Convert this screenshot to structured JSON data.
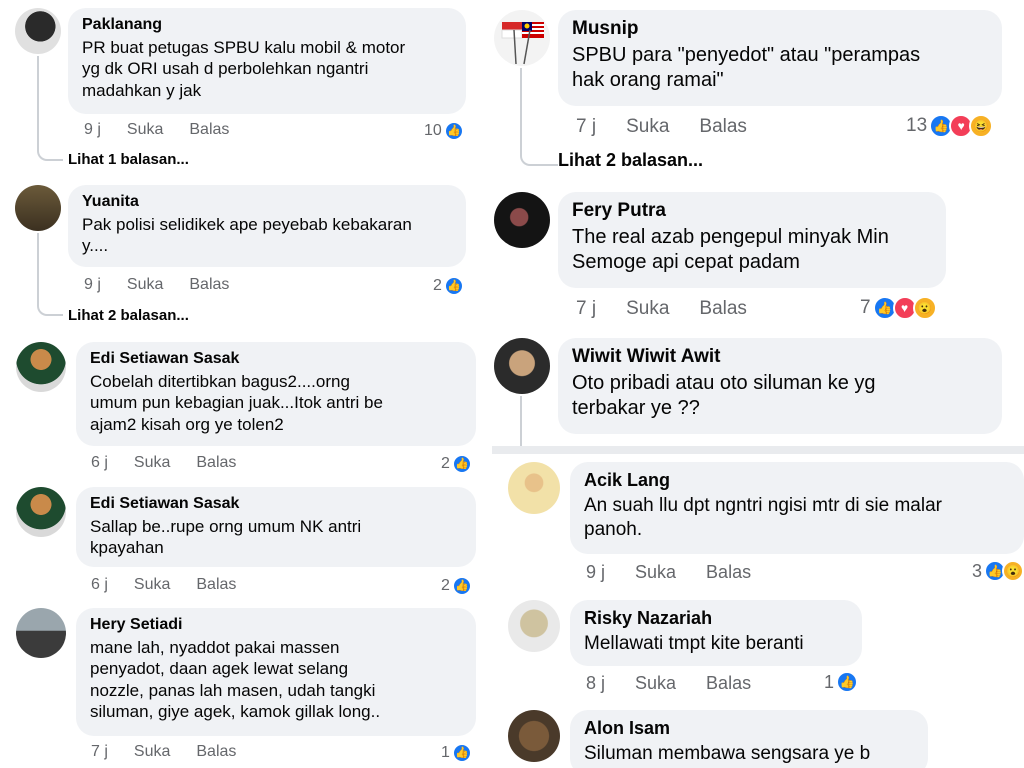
{
  "colors": {
    "like": "#1877f2",
    "love": "#f33e58",
    "haha": "#f7b125",
    "bubble": "#f0f2f5",
    "meta": "#65676b"
  },
  "left": {
    "comments": [
      {
        "name": "Paklanang",
        "text": "PR buat petugas SPBU kalu mobil & motor\nyg dk ORI usah d perbolehkan ngantri\nmadahkan y jak",
        "time": "9 j",
        "like": "Suka",
        "reply": "Balas",
        "count": "10",
        "replies": "Lihat 1 balasan..."
      },
      {
        "name": "Yuanita",
        "text": "Pak polisi selidikek ape peyebab kebakaran\ny....",
        "time": "9 j",
        "like": "Suka",
        "reply": "Balas",
        "count": "2",
        "replies": "Lihat 2 balasan..."
      },
      {
        "name": "Edi Setiawan Sasak",
        "text": "Cobelah ditertibkan bagus2....orng\numum pun kebagian juak...Itok antri be\najam2 kisah org ye tolen2",
        "time": "6 j",
        "like": "Suka",
        "reply": "Balas",
        "count": "2"
      },
      {
        "name": "Edi Setiawan Sasak",
        "text": "Sallap be..rupe orng umum NK antri\nkpayahan",
        "time": "6 j",
        "like": "Suka",
        "reply": "Balas",
        "count": "2"
      },
      {
        "name": "Hery Setiadi",
        "text": "mane lah, nyaddot pakai massen\npenyadot, daan agek lewat selang\nnozzle, panas lah masen, udah tangki\nsiluman, giye agek, kamok gillak long..",
        "time": "7 j",
        "like": "Suka",
        "reply": "Balas",
        "count": "1"
      }
    ]
  },
  "right_top": {
    "comments": [
      {
        "name": "Musnip",
        "text": "SPBU para \"penyedot\" atau \"perampas\nhak orang ramai\"",
        "time": "7 j",
        "like": "Suka",
        "reply": "Balas",
        "count": "13",
        "replies": "Lihat 2 balasan..."
      },
      {
        "name": "Fery Putra",
        "text": "The real azab pengepul minyak Min\nSemoge api cepat padam",
        "time": "7 j",
        "like": "Suka",
        "reply": "Balas",
        "count": "7"
      },
      {
        "name": "Wiwit Wiwit Awit",
        "text": "Oto pribadi atau oto siluman ke yg\nterbakar ye ??"
      }
    ]
  },
  "right_bottom": {
    "comments": [
      {
        "name": "Acik Lang",
        "text": "An suah llu dpt ngntri ngisi mtr di sie malar\npanoh.",
        "time": "9 j",
        "like": "Suka",
        "reply": "Balas",
        "count": "3"
      },
      {
        "name": "Risky Nazariah",
        "text": "Mellawati tmpt kite beranti",
        "time": "8 j",
        "like": "Suka",
        "reply": "Balas",
        "count": "1"
      },
      {
        "name": "Alon Isam",
        "text": "Siluman membawa sengsara ye b"
      }
    ]
  },
  "icons": {
    "like": "like-icon",
    "love": "love-icon",
    "haha": "haha-icon",
    "wow": "wow-icon"
  }
}
